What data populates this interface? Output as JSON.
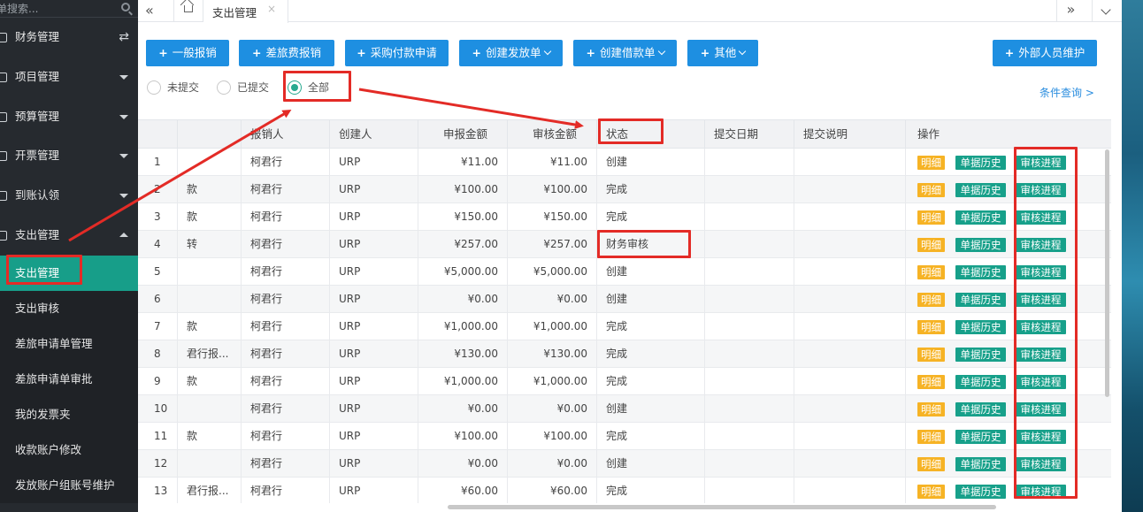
{
  "sidebar": {
    "search_placeholder": "单搜索...",
    "menu": [
      {
        "label": "财务管理"
      },
      {
        "label": "项目管理"
      },
      {
        "label": "预算管理"
      },
      {
        "label": "开票管理"
      },
      {
        "label": "到账认领"
      },
      {
        "label": "支出管理"
      }
    ],
    "submenu": [
      {
        "label": "支出管理"
      },
      {
        "label": "支出审核"
      },
      {
        "label": "差旅申请单管理"
      },
      {
        "label": "差旅申请单审批"
      },
      {
        "label": "我的发票夹"
      },
      {
        "label": "收款账户修改"
      },
      {
        "label": "发放账户组账号维护"
      }
    ]
  },
  "tabs": {
    "active": "支出管理",
    "close": "×",
    "collapse": "«",
    "forward": "»"
  },
  "toolbar": {
    "general_reimburse": "一般报销",
    "travel_reimburse": "差旅费报销",
    "purchase_payment": "采购付款申请",
    "create_payout": "创建发放单",
    "create_loan": "创建借款单",
    "other": "其他",
    "external_staff": "外部人员维护",
    "plus": "+"
  },
  "filter": {
    "not_submitted": "未提交",
    "submitted": "已提交",
    "all": "全部",
    "condition_query": "条件查询 >"
  },
  "table": {
    "headers": {
      "handler": "报销人",
      "creator": "创建人",
      "amount": "申报金额",
      "approved": "审核金额",
      "status": "状态",
      "submit_date": "提交日期",
      "submit_note": "提交说明",
      "action": "操作"
    },
    "actions": {
      "detail": "明细",
      "history": "单据历史",
      "progress": "审核进程"
    },
    "rows": [
      {
        "no": "1",
        "title": "",
        "handler": "柯君行",
        "creator": "URP",
        "amount": "¥11.00",
        "approved": "¥11.00",
        "status": "创建"
      },
      {
        "no": "2",
        "title": "款",
        "handler": "柯君行",
        "creator": "URP",
        "amount": "¥100.00",
        "approved": "¥100.00",
        "status": "完成"
      },
      {
        "no": "3",
        "title": "款",
        "handler": "柯君行",
        "creator": "URP",
        "amount": "¥150.00",
        "approved": "¥150.00",
        "status": "完成"
      },
      {
        "no": "4",
        "title": "转",
        "handler": "柯君行",
        "creator": "URP",
        "amount": "¥257.00",
        "approved": "¥257.00",
        "status": "财务审核"
      },
      {
        "no": "5",
        "title": "",
        "handler": "柯君行",
        "creator": "URP",
        "amount": "¥5,000.00",
        "approved": "¥5,000.00",
        "status": "创建"
      },
      {
        "no": "6",
        "title": "",
        "handler": "柯君行",
        "creator": "URP",
        "amount": "¥0.00",
        "approved": "¥0.00",
        "status": "创建"
      },
      {
        "no": "7",
        "title": "款",
        "handler": "柯君行",
        "creator": "URP",
        "amount": "¥1,000.00",
        "approved": "¥1,000.00",
        "status": "完成"
      },
      {
        "no": "8",
        "title": "君行报...",
        "handler": "柯君行",
        "creator": "URP",
        "amount": "¥130.00",
        "approved": "¥130.00",
        "status": "完成"
      },
      {
        "no": "9",
        "title": "款",
        "handler": "柯君行",
        "creator": "URP",
        "amount": "¥1,000.00",
        "approved": "¥1,000.00",
        "status": "完成"
      },
      {
        "no": "10",
        "title": "",
        "handler": "柯君行",
        "creator": "URP",
        "amount": "¥0.00",
        "approved": "¥0.00",
        "status": "创建"
      },
      {
        "no": "11",
        "title": "款",
        "handler": "柯君行",
        "creator": "URP",
        "amount": "¥100.00",
        "approved": "¥100.00",
        "status": "完成"
      },
      {
        "no": "12",
        "title": "",
        "handler": "柯君行",
        "creator": "URP",
        "amount": "¥0.00",
        "approved": "¥0.00",
        "status": "创建"
      },
      {
        "no": "13",
        "title": "君行报...",
        "handler": "柯君行",
        "creator": "URP",
        "amount": "¥60.00",
        "approved": "¥60.00",
        "status": "完成"
      }
    ]
  },
  "colors": {
    "accent": "#179e89",
    "primary": "#1e8fe1",
    "annotation": "#e32b26",
    "tag_yellow": "#f6b325"
  }
}
